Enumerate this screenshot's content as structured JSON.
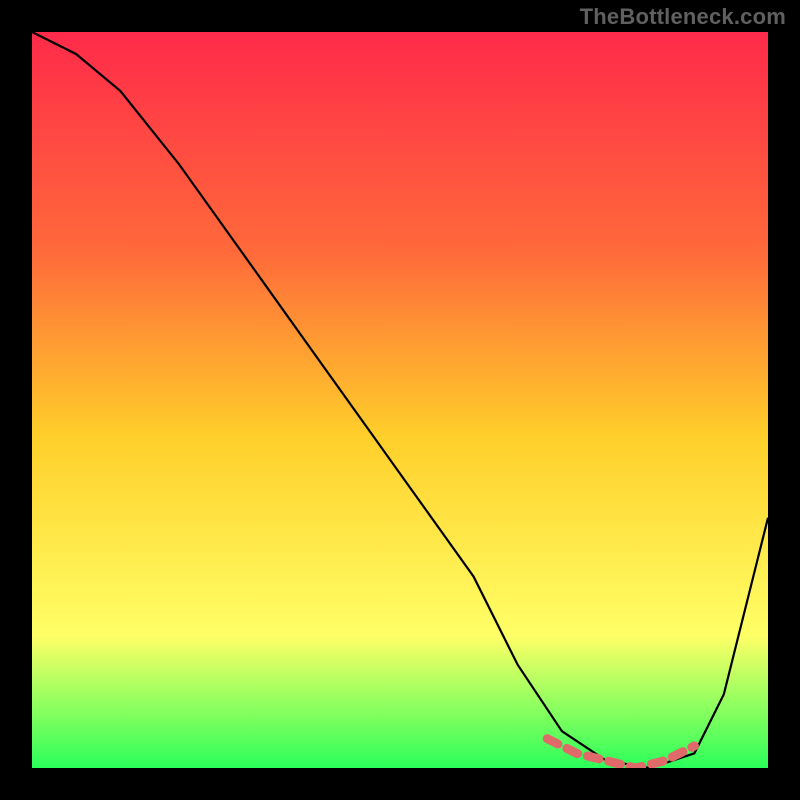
{
  "watermark": "TheBottleneck.com",
  "colors": {
    "frame": "#000000",
    "gradient_top": "#ff2a4a",
    "gradient_mid1": "#ff6a3a",
    "gradient_mid2": "#ffcf2a",
    "gradient_mid3": "#ffff66",
    "gradient_bottom": "#2bff5a",
    "curve": "#000000",
    "highlight": "#e06a6a"
  },
  "chart_data": {
    "type": "line",
    "title": "",
    "xlabel": "",
    "ylabel": "",
    "xlim": [
      0,
      100
    ],
    "ylim": [
      0,
      100
    ],
    "series": [
      {
        "name": "bottleneck-curve",
        "x": [
          0,
          6,
          12,
          20,
          30,
          40,
          50,
          60,
          66,
          72,
          78,
          84,
          90,
          94,
          100
        ],
        "y": [
          100,
          97,
          92,
          82,
          68,
          54,
          40,
          26,
          14,
          5,
          1,
          0,
          2,
          10,
          34
        ]
      }
    ],
    "highlight_range": {
      "name": "optimal-zone",
      "x": [
        70,
        74,
        78,
        82,
        86,
        90
      ],
      "y": [
        4,
        2,
        1,
        0,
        1,
        3
      ]
    }
  }
}
